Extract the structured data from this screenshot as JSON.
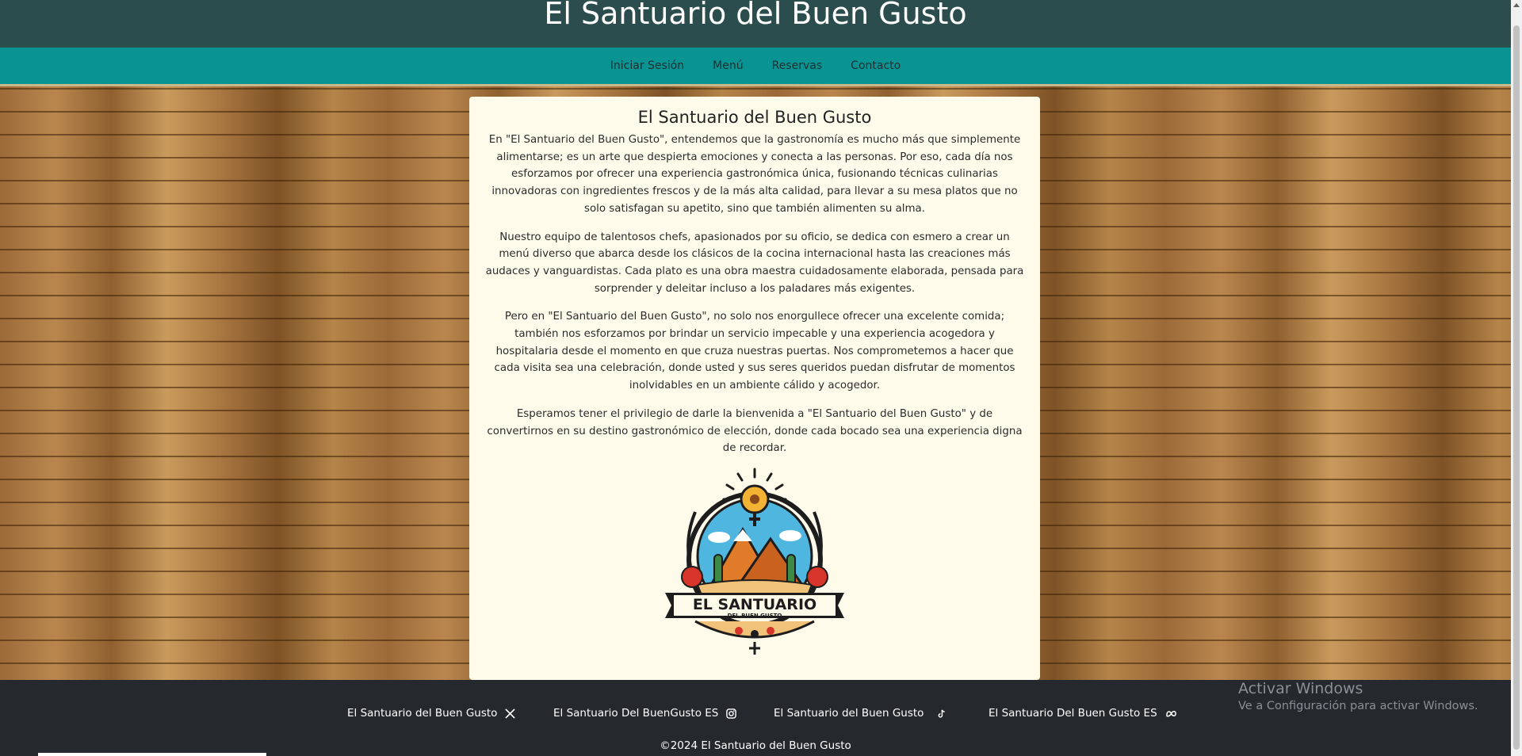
{
  "header": {
    "title": "El Santuario del Buen Gusto"
  },
  "nav": {
    "items": [
      {
        "label": "Iniciar Sesión"
      },
      {
        "label": "Menú"
      },
      {
        "label": "Reservas"
      },
      {
        "label": "Contacto"
      }
    ]
  },
  "card": {
    "title": "El Santuario del Buen Gusto",
    "paragraphs": [
      "En \"El Santuario del Buen Gusto\", entendemos que la gastronomía es mucho más que simplemente alimentarse; es un arte que despierta emociones y conecta a las personas. Por eso, cada día nos esforzamos por ofrecer una experiencia gastronómica única, fusionando técnicas culinarias innovadoras con ingredientes frescos y de la más alta calidad, para llevar a su mesa platos que no solo satisfagan su apetito, sino que también alimenten su alma.",
      "Nuestro equipo de talentosos chefs, apasionados por su oficio, se dedica con esmero a crear un menú diverso que abarca desde los clásicos de la cocina internacional hasta las creaciones más audaces y vanguardistas. Cada plato es una obra maestra cuidadosamente elaborada, pensada para sorprender y deleitar incluso a los paladares más exigentes.",
      "Pero en \"El Santuario del Buen Gusto\", no solo nos enorgullece ofrecer una excelente comida; también nos esforzamos por brindar un servicio impecable y una experiencia acogedora y hospitalaria desde el momento en que cruza nuestras puertas. Nos comprometemos a hacer que cada visita sea una celebración, donde usted y sus seres queridos puedan disfrutar de momentos inolvidables en un ambiente cálido y acogedor.",
      "Esperamos tener el privilegio de darle la bienvenida a \"El Santuario del Buen Gusto\" y de convertirnos en su destino gastronómico de elección, donde cada bocado sea una experiencia digna de recordar."
    ],
    "logo": {
      "line1": "EL SANTUARIO",
      "line2": "DEL BUEN GUSTO"
    }
  },
  "footer": {
    "social": [
      {
        "label": "El Santuario del Buen Gusto",
        "icon": "x-icon"
      },
      {
        "label": "El Santuario Del BuenGusto ES",
        "icon": "instagram-icon"
      },
      {
        "label": "El Santuario del Buen Gusto",
        "icon": "tiktok-icon"
      },
      {
        "label": "El Santuario Del Buen Gusto ES",
        "icon": "meta-icon"
      }
    ],
    "copyright": "©2024 El Santuario del Buen Gusto"
  },
  "watermark": {
    "title": "Activar Windows",
    "subtitle": "Ve a Configuración para activar Windows."
  },
  "colors": {
    "header_bg": "#2c4d4e",
    "nav_bg": "#0a9393",
    "card_bg": "#fffbeb",
    "footer_bg": "#25292e"
  }
}
